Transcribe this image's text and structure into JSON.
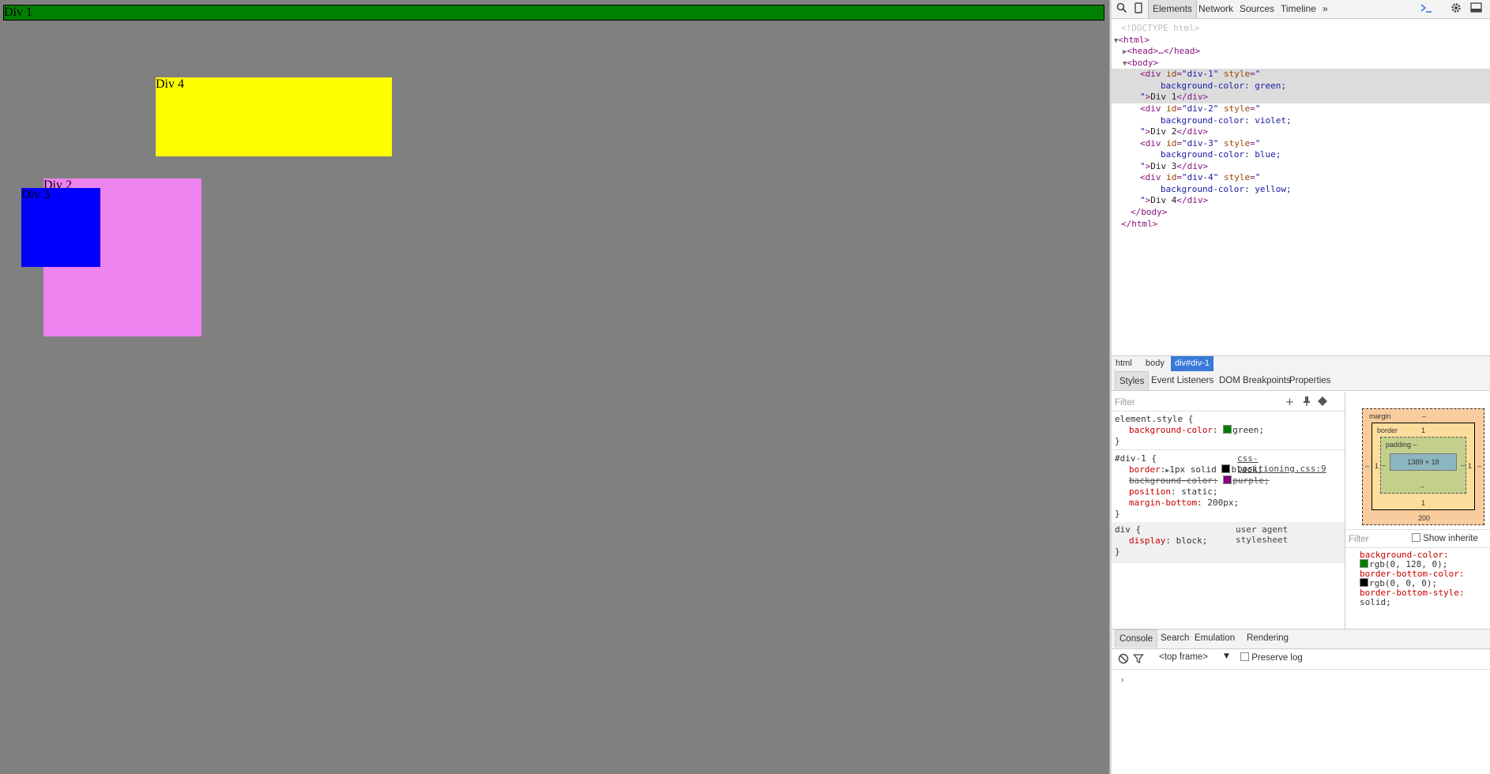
{
  "page": {
    "div1": {
      "label": "Div 1",
      "color": "#008000"
    },
    "div2": {
      "label": "Div 2",
      "color": "#ee82ee"
    },
    "div3": {
      "label": "Div 3",
      "color": "#0000ff"
    },
    "div4": {
      "label": "Div 4",
      "color": "#ffff00"
    },
    "background": "#808080"
  },
  "devtools": {
    "toolbar": {
      "search_icon": "search-icon",
      "device_icon": "device-mode-icon",
      "tabs": [
        "Elements",
        "Network",
        "Sources",
        "Timeline"
      ],
      "more": "»",
      "active_tab": "Elements"
    },
    "dom": {
      "doctype": "<!DOCTYPE html>",
      "html_open": "<html>",
      "head": "<head>…</head>",
      "body_open": "<body>",
      "divs": [
        {
          "id": "div-1",
          "bg": "green",
          "text": "Div 1"
        },
        {
          "id": "div-2",
          "bg": "violet",
          "text": "Div 2"
        },
        {
          "id": "div-3",
          "bg": "blue",
          "text": "Div 3"
        },
        {
          "id": "div-4",
          "bg": "yellow",
          "text": "Div 4"
        }
      ],
      "body_close": "</body>",
      "html_close": "</html>"
    },
    "breadcrumbs": [
      "html",
      "body",
      "div#div-1"
    ],
    "subtabs": [
      "Styles",
      "Event Listeners",
      "DOM Breakpoints",
      "Properties"
    ],
    "styles": {
      "filter_placeholder": "Filter",
      "element_style": {
        "selector": "element.style {",
        "prop": "background-color",
        "value": "green;"
      },
      "id_rule": {
        "selector": "#div-1 {",
        "source": "css-positioning.css:9",
        "border_prop": "border",
        "border_value": "1px solid",
        "border_color": "black;",
        "bg_prop": "background-color:",
        "bg_value": "purple;",
        "position_prop": "position",
        "position_value": "static;",
        "margin_prop": "margin-bottom",
        "margin_value": "200px;"
      },
      "div_rule": {
        "selector": "div {",
        "source": "user agent stylesheet",
        "prop": "display",
        "value": "block;"
      },
      "close": "}"
    },
    "metrics": {
      "margin_label": "margin",
      "margin_dash": "–",
      "border_label": "border",
      "border_value": "1",
      "padding_label": "padding –",
      "content": "1389 × 18",
      "left_border": "1",
      "right_border": "1",
      "bottom_border": "1",
      "bottom_margin": "200",
      "dash": "–"
    },
    "computed": {
      "filter_placeholder": "Filter",
      "show_inherited": "Show inherite",
      "items": [
        {
          "prop": "background-color:",
          "value": "rgb(0, 128, 0);",
          "swatch": "#008000"
        },
        {
          "prop": "border-bottom-color:",
          "value": "rgb(0, 0, 0);",
          "swatch": "#000000"
        },
        {
          "prop": "border-bottom-style:",
          "value": "solid;",
          "swatch": ""
        }
      ]
    },
    "console": {
      "tabs": [
        "Console",
        "Search",
        "Emulation",
        "Rendering"
      ],
      "frame": "<top frame>",
      "preserve_log": "Preserve log",
      "prompt": "›"
    }
  }
}
